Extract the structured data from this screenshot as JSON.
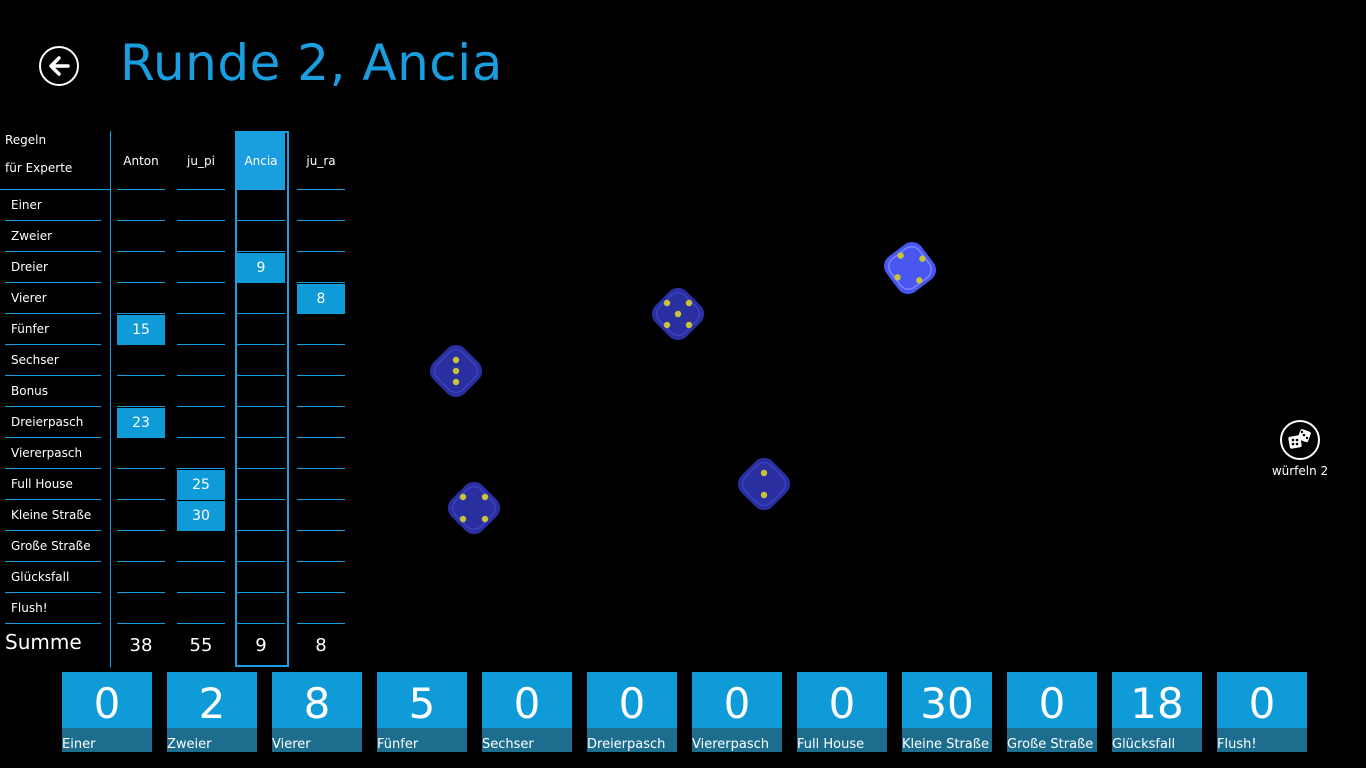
{
  "header": {
    "title": "Runde 2, Ancia"
  },
  "rules": {
    "line1": "Regeln",
    "line2": "für Experte"
  },
  "players": [
    "Anton",
    "ju_pi",
    "Ancia",
    "ju_ra"
  ],
  "rows": [
    "Einer",
    "Zweier",
    "Dreier",
    "Vierer",
    "Fünfer",
    "Sechser",
    "Bonus",
    "Dreierpasch",
    "Viererpasch",
    "Full House",
    "Kleine Straße",
    "Große Straße",
    "Glücksfall",
    "Flush!"
  ],
  "scores": [
    [
      "",
      "",
      "",
      "",
      "15",
      "",
      "",
      "23",
      "",
      "",
      "",
      "",
      "",
      ""
    ],
    [
      "",
      "",
      "",
      "",
      "",
      "",
      "",
      "",
      "",
      "25",
      "30",
      "",
      "",
      ""
    ],
    [
      "",
      "",
      "9",
      "",
      "",
      "",
      "",
      "",
      "",
      "",
      "",
      "",
      "",
      ""
    ],
    [
      "",
      "",
      "",
      "8",
      "",
      "",
      "",
      "",
      "",
      "",
      "",
      "",
      "",
      ""
    ]
  ],
  "sum_label": "Summe",
  "sums": [
    "38",
    "55",
    "9",
    "8"
  ],
  "dice": [
    {
      "value": 4,
      "held": true
    },
    {
      "value": 5,
      "held": false
    },
    {
      "value": 3,
      "held": false
    },
    {
      "value": 4,
      "held": false
    },
    {
      "value": 2,
      "held": false
    }
  ],
  "roll": {
    "label": "würfeln 2"
  },
  "options": [
    {
      "value": "0",
      "label": "Einer"
    },
    {
      "value": "2",
      "label": "Zweier"
    },
    {
      "value": "8",
      "label": "Vierer"
    },
    {
      "value": "5",
      "label": "Fünfer"
    },
    {
      "value": "0",
      "label": "Sechser"
    },
    {
      "value": "0",
      "label": "Dreierpasch"
    },
    {
      "value": "0",
      "label": "Viererpasch"
    },
    {
      "value": "0",
      "label": "Full House"
    },
    {
      "value": "30",
      "label": "Kleine Straße"
    },
    {
      "value": "0",
      "label": "Große Straße"
    },
    {
      "value": "18",
      "label": "Glücksfall"
    },
    {
      "value": "0",
      "label": "Flush!"
    }
  ],
  "colors": {
    "accent": "#1b9ee0",
    "tile": "#0f9ad8",
    "tile_label": "#1d6e8e",
    "die": "#2a2fa0",
    "die_held": "#4a56f0",
    "pip": "#c9c33a"
  }
}
